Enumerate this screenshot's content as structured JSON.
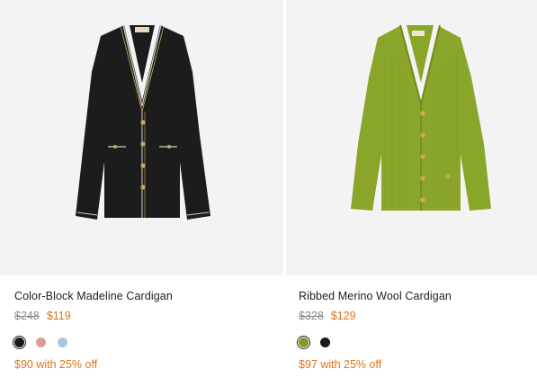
{
  "products": [
    {
      "title": "Color-Block Madeline Cardigan",
      "old_price": "$248",
      "new_price": "$119",
      "promo": "$90 with 25% off",
      "swatch_colors": [
        "#1a1a1a",
        "#d8a090",
        "#a9c6de"
      ],
      "image_icon": "black-cardigan-image"
    },
    {
      "title": "Ribbed Merino Wool Cardigan",
      "old_price": "$328",
      "new_price": "$129",
      "promo": "$97 with 25% off",
      "swatch_colors": [
        "#7f9a26",
        "#1a1a1a"
      ],
      "image_icon": "green-cardigan-image"
    }
  ],
  "colors": {
    "sale": "#d9751e",
    "old_price": "#8a8a8a",
    "image_bg": "#f3f3f3"
  }
}
